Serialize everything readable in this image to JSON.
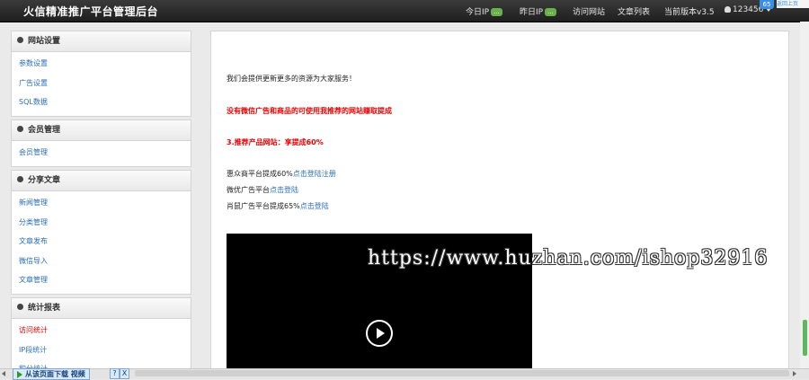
{
  "app_title": "火信精准推广平台管理后台",
  "topnav": {
    "today_ip": "今日IP",
    "today_ip_badge": "...",
    "yesterday_ip": "昨日IP",
    "yesterday_ip_badge": "...",
    "visit_site": "访问网站",
    "article_list": "文章列表",
    "version": "当前版本v3.5",
    "user": "123456",
    "widget_label": "65",
    "widget_link": "返回上页"
  },
  "sidebar": {
    "site_settings": {
      "title": "网站设置",
      "items": [
        "参数设置",
        "广告设置",
        "SQL数据"
      ]
    },
    "members": {
      "title": "会员管理",
      "items": [
        "会员管理"
      ]
    },
    "share": {
      "title": "分享文章",
      "items": [
        "新闻管理",
        "分类管理",
        "文章发布",
        "微信导入",
        "文章管理"
      ]
    },
    "stats": {
      "title": "统计报表",
      "items": [
        "访问统计",
        "IP段统计",
        "积分统计"
      ]
    }
  },
  "content": {
    "intro": "我们会提供更新更多的资源为大家服务！",
    "notice_red": "没有微信广告和商品的可使用我推荐的网站赚取提成",
    "recommend_red": "3.推荐产品网站：享提成60%",
    "line1_text": "惠众商平台提成60%",
    "line1_link": "点击登陆注册",
    "line2_text": "微优广告平台",
    "line2_link": "点击登陆",
    "line3_text": "肖鼠广告平台提成65%",
    "line3_link": "点击登陆"
  },
  "watermark": "https://www.huzhan.com/ishop32916",
  "download_bar": {
    "label": "从该页面下载 视频",
    "help": "?",
    "close": "X"
  },
  "colors": {
    "navbar": "#2b2b2b",
    "link": "#2a6db5",
    "active": "#cc0000",
    "red_text": "#ee0000"
  }
}
